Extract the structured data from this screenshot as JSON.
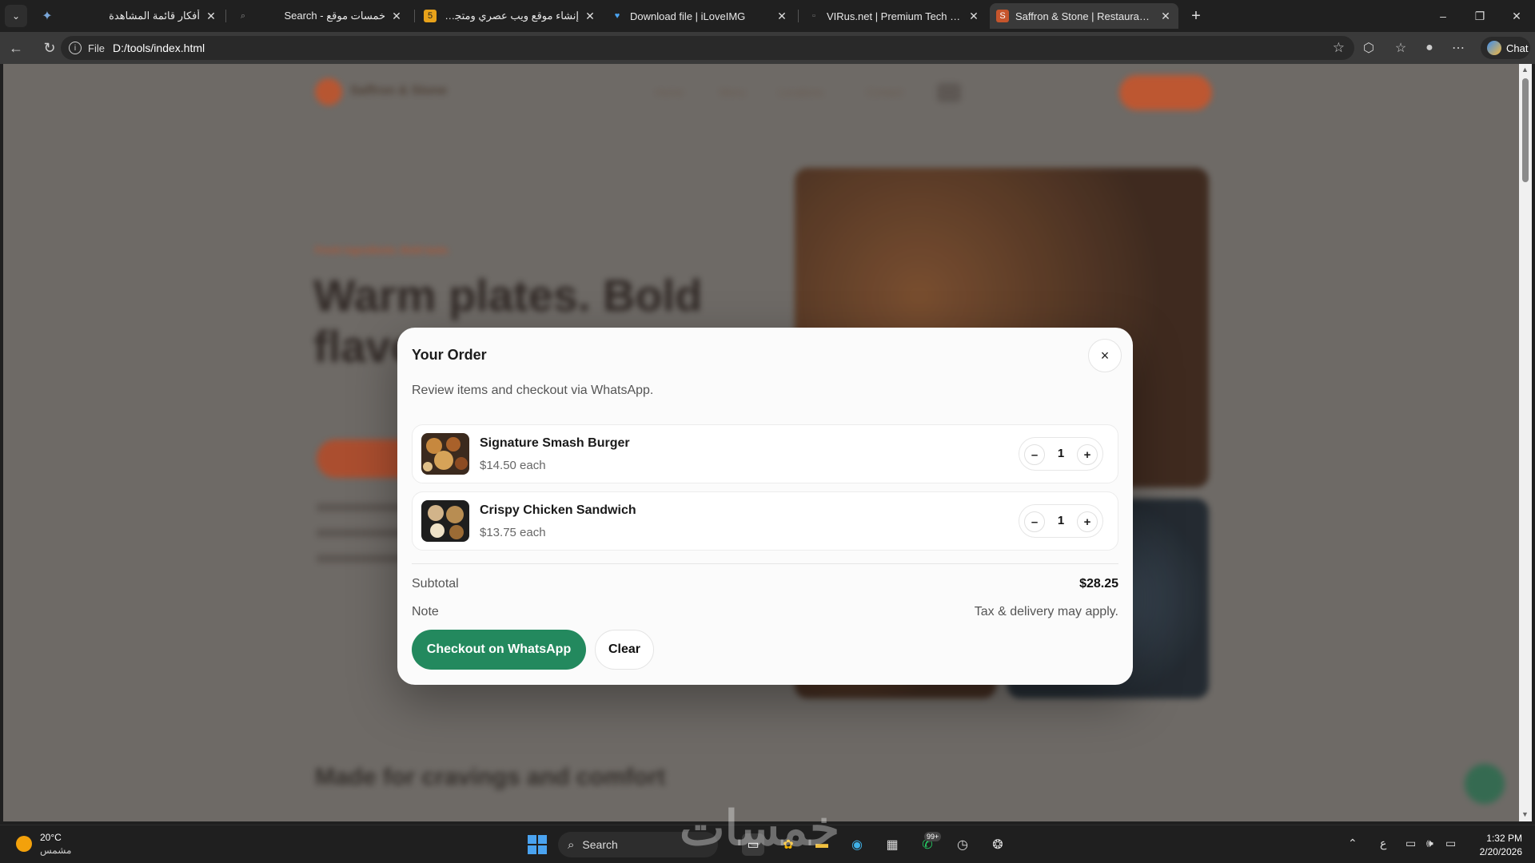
{
  "tabs": [
    {
      "title": "أفكار قائمة المشاهدة",
      "icon": "bookmark-icon"
    },
    {
      "title": "Search - خمسات موقع",
      "icon": "search-icon"
    },
    {
      "title": "إنشاء موقع ويب عصري ومتجاوب لعرض",
      "icon": "khamsat-icon"
    },
    {
      "title": "Download file | iLoveIMG",
      "icon": "heart-icon"
    },
    {
      "title": "VIRus.net | Premium Tech Cafe",
      "icon": "page-icon"
    },
    {
      "title": "Saffron & Stone | Restaurant Menu",
      "icon": "site-icon"
    }
  ],
  "address": {
    "scheme": "File",
    "url": "D:/tools/index.html"
  },
  "toolbar": {
    "chat_label": "Chat"
  },
  "site": {
    "brand": "Saffron & Stone",
    "nav": [
      "Home",
      "Menu",
      "Locations",
      "Contact"
    ],
    "lang": [
      "EN",
      "AR"
    ],
    "tagline": "Fresh ingredients. Bold taste.",
    "headline_1": "Warm plates. Bold",
    "headline_2": "flavors.",
    "section_title": "Made for cravings and comfort"
  },
  "modal": {
    "title": "Your Order",
    "subtitle": "Review items and checkout via WhatsApp.",
    "items": [
      {
        "name": "Signature Smash Burger",
        "price": "$14.50 each",
        "qty": "1"
      },
      {
        "name": "Crispy Chicken Sandwich",
        "price": "$13.75 each",
        "qty": "1"
      }
    ],
    "subtotal_label": "Subtotal",
    "subtotal_value": "$28.25",
    "note_label": "Note",
    "note_value": "Tax & delivery may apply.",
    "checkout_label": "Checkout on WhatsApp",
    "clear_label": "Clear",
    "close_glyph": "×",
    "minus_glyph": "–",
    "plus_glyph": "+"
  },
  "taskbar": {
    "temp": "20°C",
    "weather": "مشمس",
    "search_placeholder": "Search",
    "badge": "99+",
    "lang_indicator": "ع",
    "time": "1:32 PM",
    "date": "2/20/2026"
  },
  "watermark": "خمسات",
  "colors": {
    "accent": "#23895e",
    "brand": "#c6552c",
    "chrome": "#202020"
  }
}
